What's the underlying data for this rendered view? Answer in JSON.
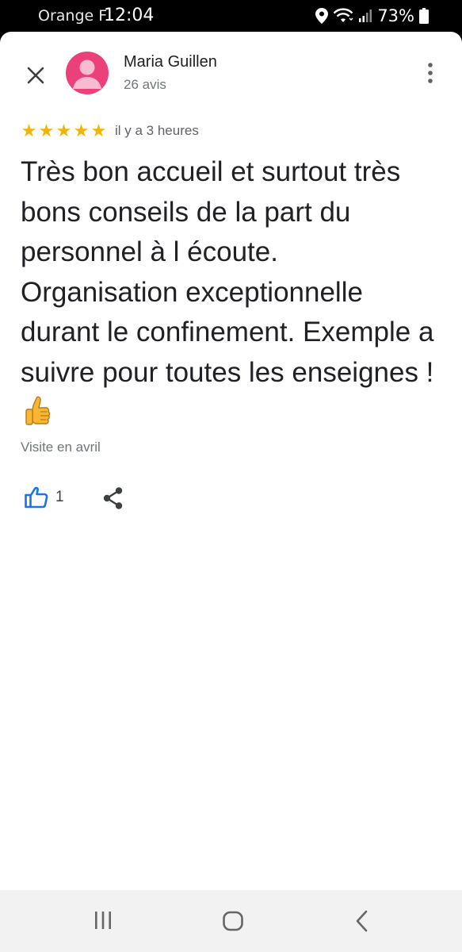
{
  "status_bar": {
    "carrier": "Orange F",
    "time": "12:04",
    "battery": "73%",
    "icons": [
      "location-icon",
      "wifi-icon",
      "signal-icon",
      "battery-icon"
    ]
  },
  "review": {
    "author": "Maria Guillen",
    "review_count": "26 avis",
    "rating": 5,
    "stars": [
      "★",
      "★",
      "★",
      "★",
      "★"
    ],
    "time_ago": "il y a 3 heures",
    "text": "Très bon accueil et surtout très bons conseils de la part du personnel à l écoute. Organisation exceptionnelle durant le confinement. Exemple a suivre pour toutes les enseignes !",
    "visit": "Visite en avril",
    "likes": "1"
  },
  "colors": {
    "avatar": "#ec407a",
    "star": "#f5b400",
    "like_icon": "#1a73e8"
  },
  "nav_bar": {
    "icons": [
      "recents-icon",
      "home-icon",
      "back-icon"
    ]
  }
}
